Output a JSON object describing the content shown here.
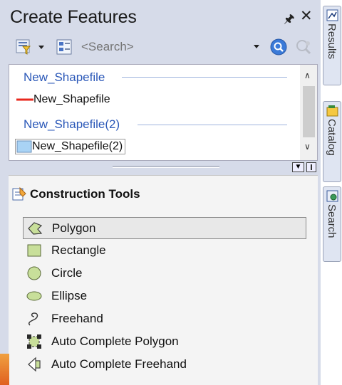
{
  "window": {
    "title": "Create Features"
  },
  "toolbar": {
    "search_placeholder": "<Search>"
  },
  "templates": {
    "groups": [
      {
        "header": "New_Shapefile",
        "item_label": "New_Shapefile",
        "symbol": "line",
        "symbol_color": "#e8281e",
        "selected": false
      },
      {
        "header": "New_Shapefile(2)",
        "item_label": "New_Shapefile(2)",
        "symbol": "polygon",
        "symbol_color": "#a9d3f5",
        "selected": true
      }
    ]
  },
  "construction": {
    "title": "Construction Tools",
    "tools": [
      {
        "label": "Polygon",
        "icon": "polygon-icon",
        "selected": true
      },
      {
        "label": "Rectangle",
        "icon": "rectangle-icon",
        "selected": false
      },
      {
        "label": "Circle",
        "icon": "circle-icon",
        "selected": false
      },
      {
        "label": "Ellipse",
        "icon": "ellipse-icon",
        "selected": false
      },
      {
        "label": "Freehand",
        "icon": "freehand-icon",
        "selected": false
      },
      {
        "label": "Auto Complete Polygon",
        "icon": "auto-complete-polygon-icon",
        "selected": false
      },
      {
        "label": "Auto Complete Freehand",
        "icon": "auto-complete-freehand-icon",
        "selected": false
      }
    ]
  },
  "dock_tabs": [
    {
      "label": "Results",
      "icon": "results-icon"
    },
    {
      "label": "Catalog",
      "icon": "catalog-icon"
    },
    {
      "label": "Search",
      "icon": "search-tab-icon"
    }
  ],
  "colors": {
    "panel_bg": "#d6dbe9",
    "group_header": "#2b58b8",
    "tool_fill": "#c8df9a"
  }
}
